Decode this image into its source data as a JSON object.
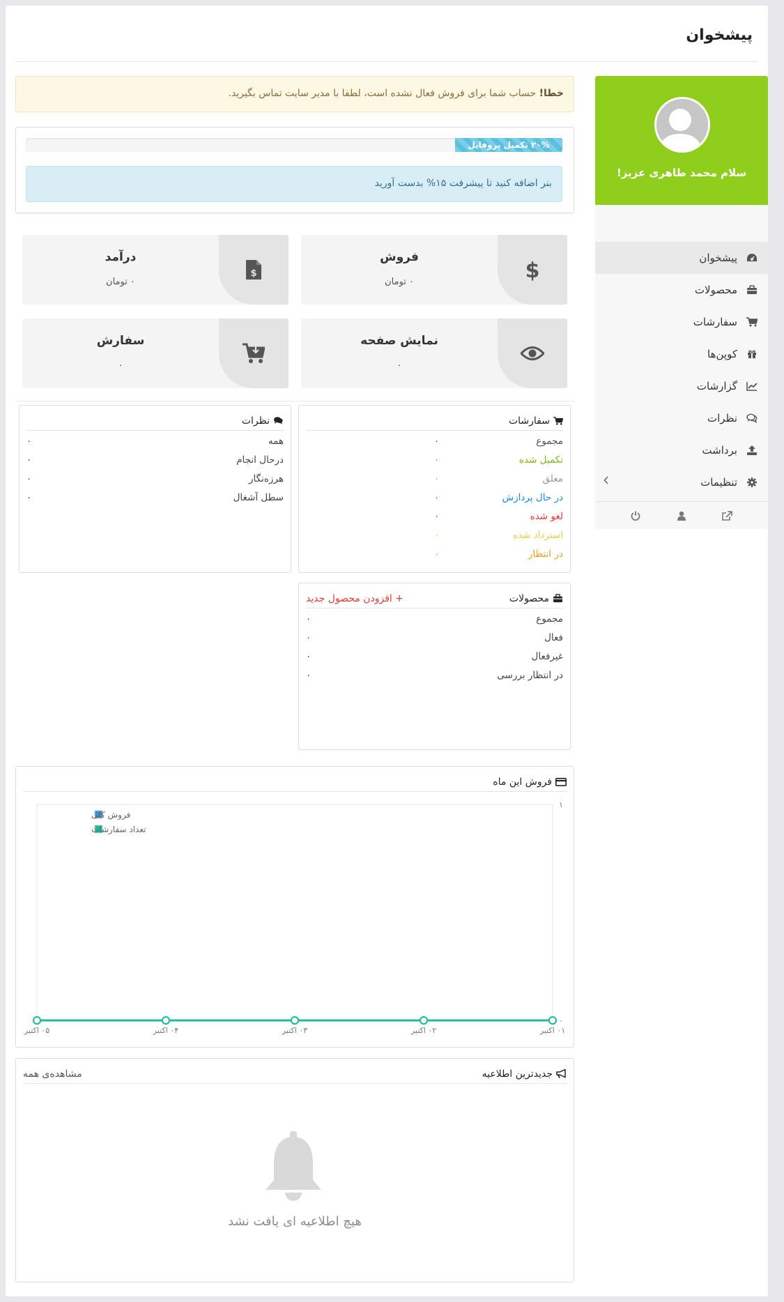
{
  "page": {
    "title": "پیشخوان"
  },
  "sidebar": {
    "greeting": "سلام محمد طاهری عزیز!",
    "items": [
      {
        "label": "پیشخوان",
        "icon": "dashboard-icon",
        "active": true
      },
      {
        "label": "محصولات",
        "icon": "briefcase-icon"
      },
      {
        "label": "سفارشات",
        "icon": "cart-icon"
      },
      {
        "label": "کوپن‌ها",
        "icon": "gift-icon"
      },
      {
        "label": "گزارشات",
        "icon": "line-chart-icon"
      },
      {
        "label": "نظرات",
        "icon": "comments-icon"
      },
      {
        "label": "برداشت",
        "icon": "upload-icon"
      },
      {
        "label": "تنظیمات",
        "icon": "gear-icon"
      }
    ],
    "bottom_icons": [
      "external-link-icon",
      "user-icon",
      "power-icon"
    ]
  },
  "alert": {
    "strong": "خطا!",
    "text": " حساب شما برای فروش فعال نشده است، لطفا با مدیر سایت تماس بگیرید."
  },
  "profile": {
    "progress_label": "۲۰% تکمیل پروفایل",
    "progress_value": 20,
    "hint": "بنر اضافه کنید تا پیشرفت ۱۵% بدست آورید"
  },
  "stats": {
    "sales": {
      "label": "فروش",
      "value": "۰ تومان"
    },
    "income": {
      "label": "درآمد",
      "value": "۰ تومان"
    },
    "pageviews": {
      "label": "نمایش صفحه",
      "value": "۰"
    },
    "orders": {
      "label": "سفارش",
      "value": "۰"
    }
  },
  "orders_panel": {
    "title": "سفارشات",
    "rows": [
      {
        "label": "مجموع",
        "value": "۰",
        "color": "#555555"
      },
      {
        "label": "تکمیل شده",
        "value": "۰",
        "color": "#7cb518"
      },
      {
        "label": "معلق",
        "value": "۰",
        "color": "#999999"
      },
      {
        "label": "در حال پردازش",
        "value": "۰",
        "color": "#1e88e5"
      },
      {
        "label": "لغو شده",
        "value": "۰",
        "color": "#e53935"
      },
      {
        "label": "استرداد شده",
        "value": "۰",
        "color": "#f2c94c"
      },
      {
        "label": "در انتظار",
        "value": "۰",
        "color": "#f29c1f"
      }
    ]
  },
  "reviews_panel": {
    "title": "نظرات",
    "rows": [
      {
        "label": "همه",
        "value": "۰"
      },
      {
        "label": "درحال انجام",
        "value": "۰"
      },
      {
        "label": "هرزه‌نگار",
        "value": "۰"
      },
      {
        "label": "سطل آشغال",
        "value": "۰"
      }
    ]
  },
  "products_panel": {
    "title": "محصولات",
    "add_new": "+ افزودن محصول جدید",
    "rows": [
      {
        "label": "مجموع",
        "value": "۰"
      },
      {
        "label": "فعال",
        "value": "۰"
      },
      {
        "label": "غیرفعال",
        "value": "۰"
      },
      {
        "label": "در انتظار بررسی",
        "value": "۰"
      }
    ]
  },
  "chart_data": {
    "type": "line",
    "title": "فروش این ماه",
    "x": [
      "۰۱ اکتبر",
      "۰۲ اکتبر",
      "۰۳ اکتبر",
      "۰۴ اکتبر",
      "۰۵ اکتبر"
    ],
    "y_ticks": [
      "۰",
      "۱"
    ],
    "ylim": [
      0,
      1
    ],
    "series": [
      {
        "name": "فروش کلی",
        "values": [
          0,
          0,
          0,
          0,
          0
        ],
        "color": "#3a8fd8"
      },
      {
        "name": "تعداد سفارشات",
        "values": [
          0,
          0,
          0,
          0,
          0
        ],
        "color": "#1abc9c"
      }
    ],
    "legend": "top-left",
    "grid": false
  },
  "announcements": {
    "title": "جدیدترین اطلاعیه",
    "view_all": "مشاهده‌ی همه",
    "empty": "هیچ اطلاعیه ای یافت نشد"
  }
}
